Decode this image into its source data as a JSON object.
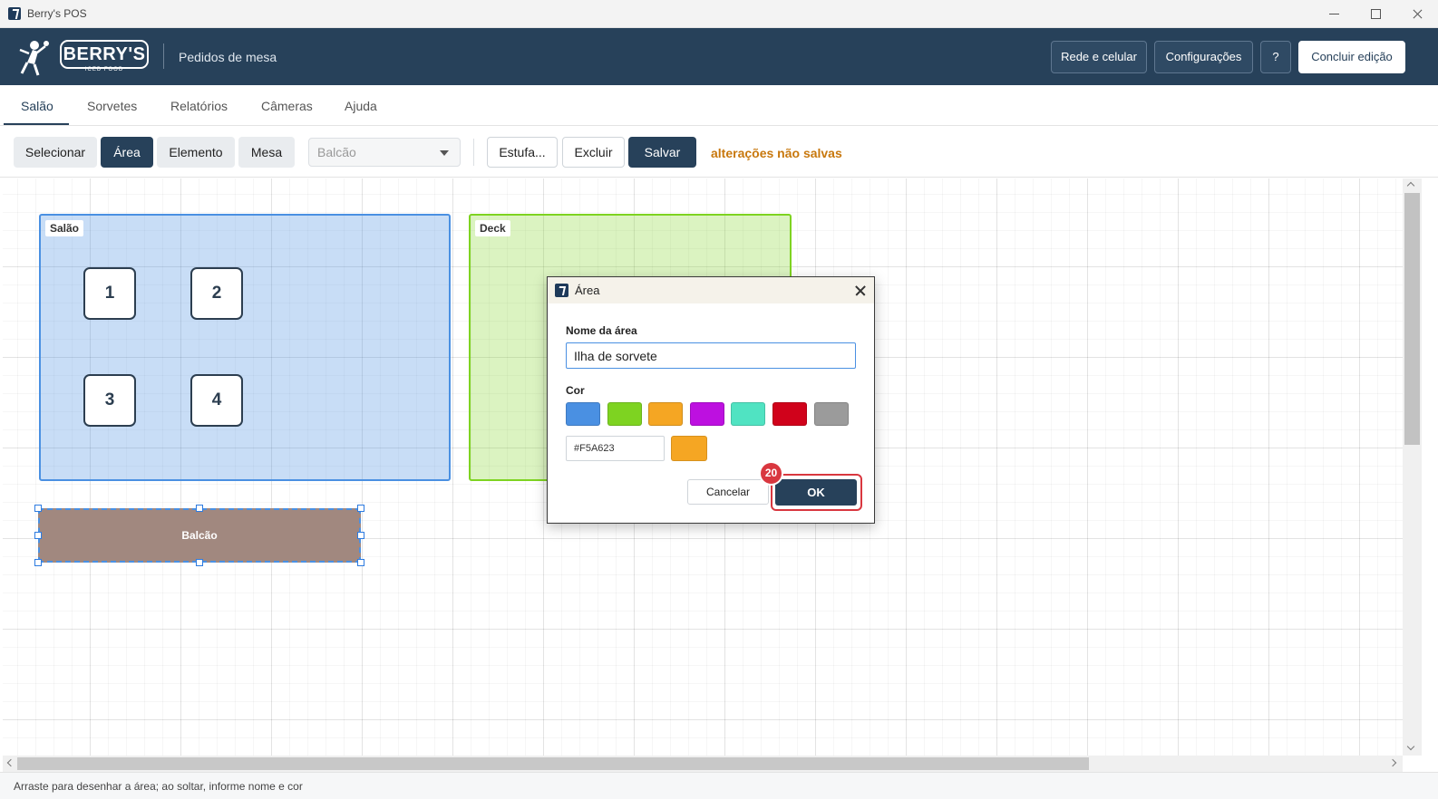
{
  "window": {
    "title": "Berry's POS"
  },
  "header": {
    "brand": "BERRY'S",
    "brand_sub": "ICED FOOD",
    "subtitle": "Pedidos de mesa",
    "buttons": {
      "network": "Rede e celular",
      "settings": "Configurações",
      "help": "?",
      "finish": "Concluir edição"
    }
  },
  "tabs": [
    {
      "label": "Salão",
      "active": true
    },
    {
      "label": "Sorvetes"
    },
    {
      "label": "Relatórios"
    },
    {
      "label": "Câmeras"
    },
    {
      "label": "Ajuda"
    }
  ],
  "toolbar": {
    "select": "Selecionar",
    "area": "Área",
    "element": "Elemento",
    "table": "Mesa",
    "dropdown_value": "Balcão",
    "stove": "Estufa...",
    "delete": "Excluir",
    "save": "Salvar",
    "unsaved": "alterações não salvas"
  },
  "canvas": {
    "areas": [
      {
        "name": "Salão",
        "color": "#4A90E2"
      },
      {
        "name": "Deck",
        "color": "#7ED321"
      }
    ],
    "tables": [
      "1",
      "2",
      "3",
      "4"
    ],
    "counter": {
      "label": "Balcão",
      "color": "#A1887F"
    }
  },
  "dialog": {
    "title": "Área",
    "name_label": "Nome da área",
    "name_value": "Ilha de sorvete",
    "color_label": "Cor",
    "swatches": [
      "#4A90E2",
      "#7ED321",
      "#F5A623",
      "#BD10E0",
      "#50E3C2",
      "#D0021B",
      "#9B9B9B"
    ],
    "hex_value": "#F5A623",
    "cancel": "Cancelar",
    "ok": "OK",
    "step_badge": "20"
  },
  "statusbar": {
    "text": "Arraste para desenhar a área; ao soltar, informe nome e cor"
  }
}
